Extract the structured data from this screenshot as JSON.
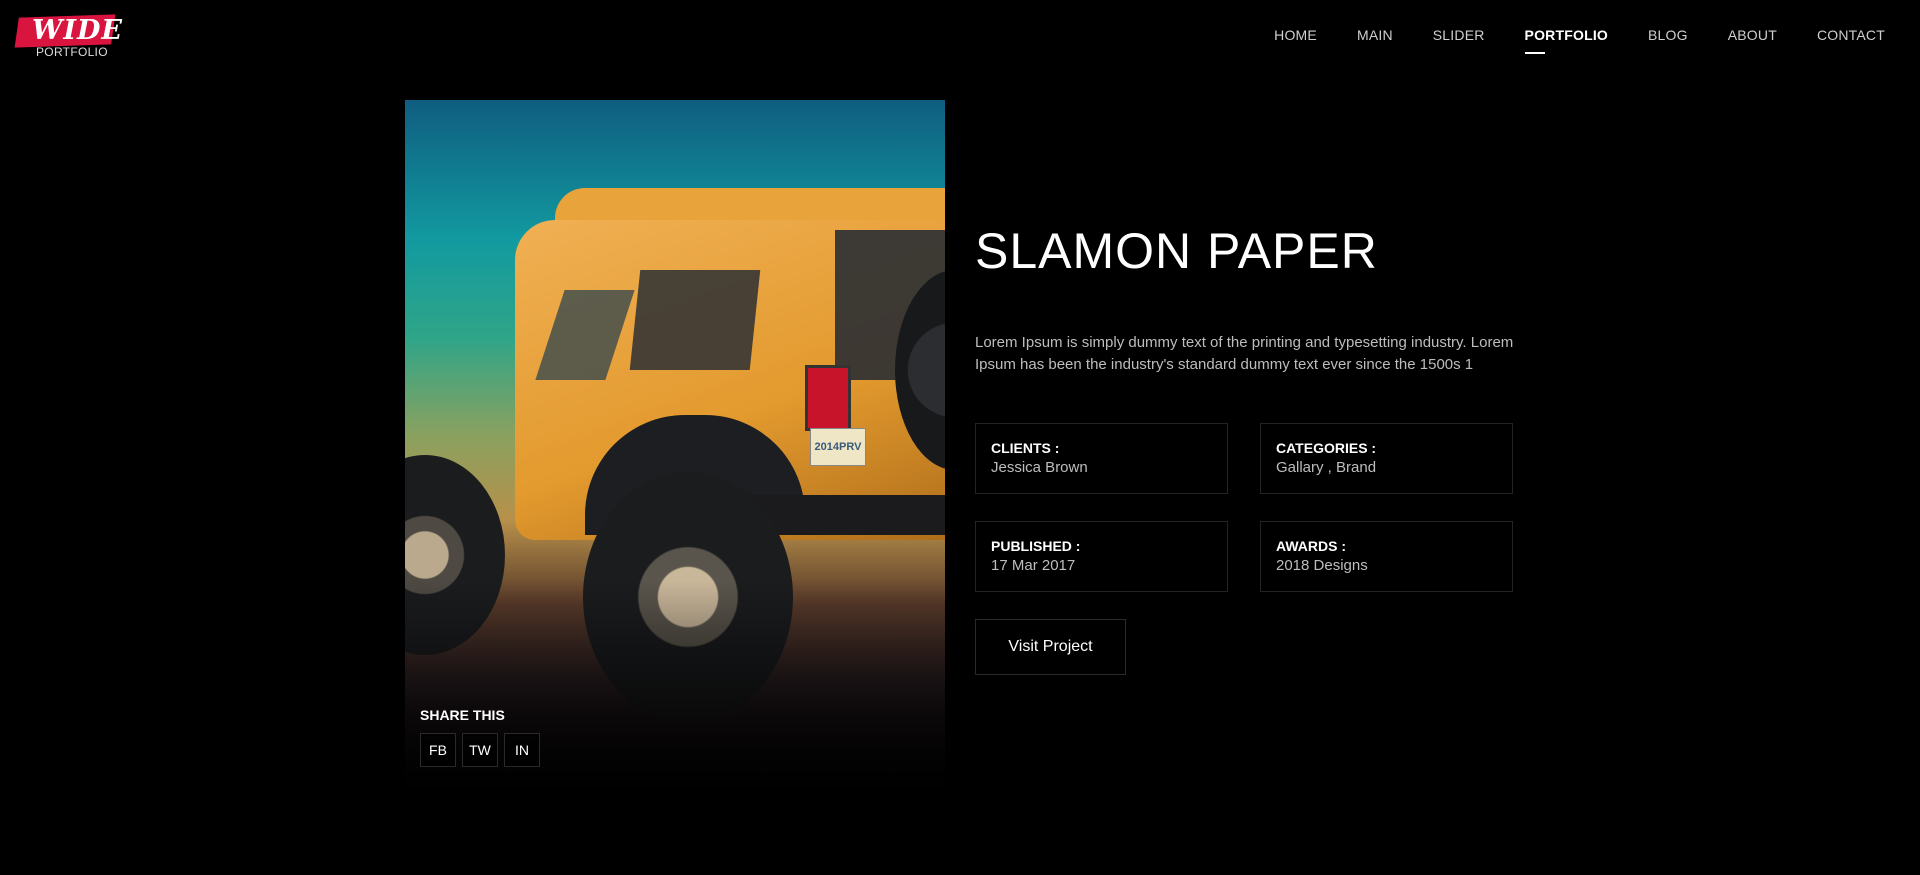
{
  "logo": {
    "word": "WIDE",
    "sub": "PORTFOLIO"
  },
  "nav": {
    "items": [
      {
        "label": "HOME"
      },
      {
        "label": "MAIN"
      },
      {
        "label": "SLIDER"
      },
      {
        "label": "PORTFOLIO",
        "active": true
      },
      {
        "label": "BLOG"
      },
      {
        "label": "ABOUT"
      },
      {
        "label": "CONTACT"
      }
    ]
  },
  "hero": {
    "plate_text": "2014PRV"
  },
  "share": {
    "title": "SHARE THIS",
    "buttons": [
      {
        "label": "FB"
      },
      {
        "label": "TW"
      },
      {
        "label": "IN"
      }
    ]
  },
  "project": {
    "title": "SLAMON PAPER",
    "description": "Lorem Ipsum is simply dummy text of the printing and typesetting industry. Lorem Ipsum has been the industry's standard dummy text ever since the 1500s 1",
    "clients": {
      "label": "CLIENTS :",
      "value": "Jessica Brown"
    },
    "categories": {
      "label": "CATEGORIES :",
      "value": "Gallary , Brand"
    },
    "published": {
      "label": "PUBLISHED :",
      "value": "17 Mar 2017"
    },
    "awards": {
      "label": "AWARDS :",
      "value": "2018 Designs"
    },
    "visit_label": "Visit Project"
  },
  "colors": {
    "background": "#000000",
    "logo_accent": "#d8143f"
  }
}
